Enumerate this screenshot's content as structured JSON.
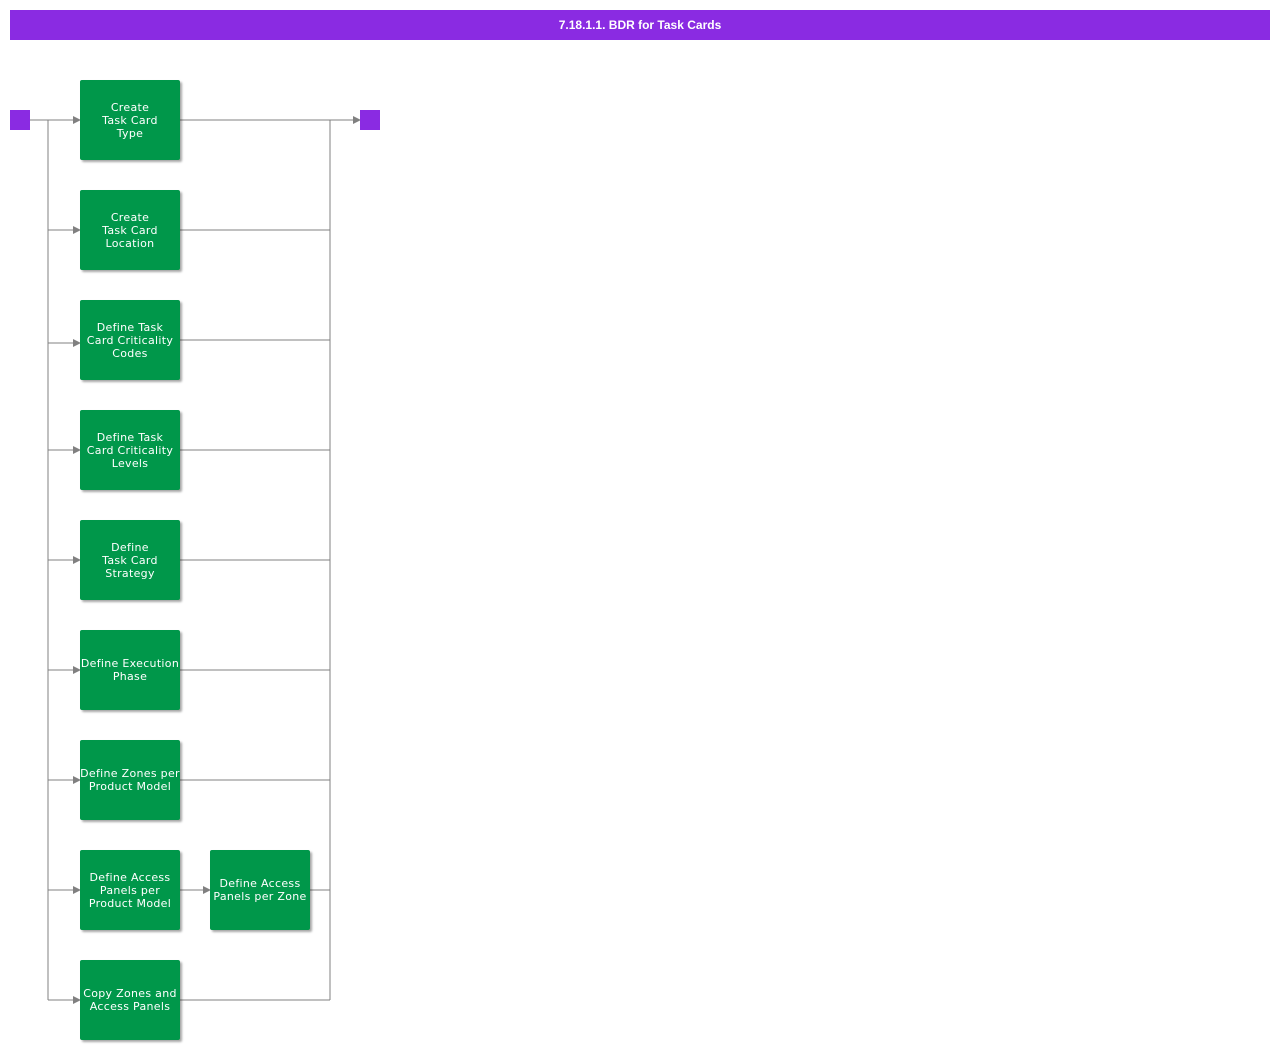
{
  "title": "7.18.1.1. BDR for Task Cards",
  "colors": {
    "title_bar": "#8a2be2",
    "terminal": "#8a2be2",
    "task_box": "#00974a",
    "connector": "#808080"
  },
  "nodes": {
    "create_task_card_type": "Create\nTask Card\nType",
    "create_task_card_location": "Create\nTask Card\nLocation",
    "define_task_card_criticality_codes": "Define Task\nCard Criticality\nCodes",
    "define_task_card_criticality_levels": "Define Task\nCard Criticality\nLevels",
    "define_task_card_strategy": "Define\nTask Card\nStrategy",
    "define_execution_phase": "Define Execution\nPhase",
    "define_zones_per_product_model": "Define Zones per\nProduct Model",
    "define_access_panels_per_product_model": "Define Access\nPanels per\nProduct Model",
    "define_access_panels_per_zone": "Define Access\nPanels per Zone",
    "copy_zones_and_access_panels": "Copy Zones and\nAccess Panels"
  }
}
